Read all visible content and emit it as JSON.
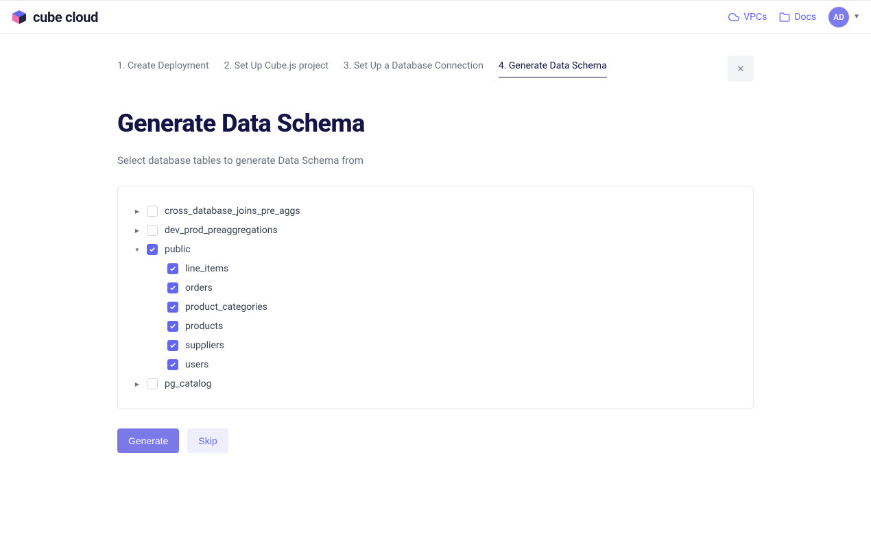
{
  "header": {
    "product_name": "cube cloud",
    "links": {
      "vpcs": "VPCs",
      "docs": "Docs"
    },
    "avatar_initials": "AD"
  },
  "steps": [
    {
      "label": "1. Create Deployment",
      "active": false
    },
    {
      "label": "2. Set Up Cube.js project",
      "active": false
    },
    {
      "label": "3. Set Up a Database Connection",
      "active": false
    },
    {
      "label": "4. Generate Data Schema",
      "active": true
    }
  ],
  "page": {
    "title": "Generate Data Schema",
    "description": "Select database tables to generate Data Schema from"
  },
  "tree": {
    "schemas": [
      {
        "name": "cross_database_joins_pre_aggs",
        "expanded": false,
        "checked": false,
        "children": []
      },
      {
        "name": "dev_prod_preaggregations",
        "expanded": false,
        "checked": false,
        "children": []
      },
      {
        "name": "public",
        "expanded": true,
        "checked": true,
        "children": [
          {
            "name": "line_items",
            "checked": true
          },
          {
            "name": "orders",
            "checked": true
          },
          {
            "name": "product_categories",
            "checked": true
          },
          {
            "name": "products",
            "checked": true
          },
          {
            "name": "suppliers",
            "checked": true
          },
          {
            "name": "users",
            "checked": true
          }
        ]
      },
      {
        "name": "pg_catalog",
        "expanded": false,
        "checked": false,
        "children": []
      }
    ]
  },
  "buttons": {
    "generate": "Generate",
    "skip": "Skip"
  }
}
